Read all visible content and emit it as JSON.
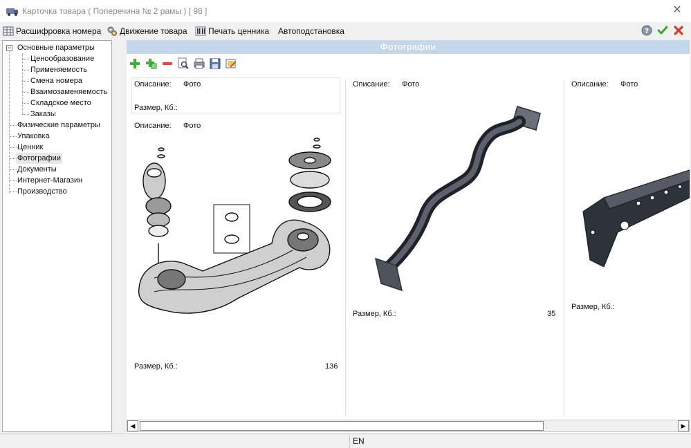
{
  "window": {
    "title": "Карточка товара ( Поперечина № 2 рамы ) [ 98 ]",
    "close_glyph": "✕"
  },
  "menu": [
    {
      "label": "Расшифровка номера",
      "icon": "table-icon"
    },
    {
      "label": "Движение товара",
      "icon": "gears-icon"
    },
    {
      "label": "Печать ценника",
      "icon": "barcode-icon"
    },
    {
      "label": "Автоподстановка",
      "icon": ""
    }
  ],
  "right_icons": [
    "help-icon",
    "confirm-check-icon",
    "cancel-x-icon"
  ],
  "tree": {
    "root": "Основные параметры",
    "children": [
      "Ценообразование",
      "Применяемость",
      "Смена номера",
      "Взаимозаменяемость",
      "Складское место",
      "Заказы"
    ],
    "siblings": [
      "Физические параметры",
      "Упаковка",
      "Ценник",
      "Фотографии",
      "Документы",
      "Интернет-Магазин",
      "Производство"
    ],
    "selected": "Фотографии",
    "expander": "−"
  },
  "section": {
    "title": "Фотографии"
  },
  "photo_toolbar": [
    "add-icon",
    "add-copy-icon",
    "remove-icon",
    "preview-icon",
    "print-icon",
    "save-icon",
    "edit-icon"
  ],
  "cards": [
    {
      "header": {
        "desc_label": "Описание:",
        "desc_value": "Фото",
        "size_label": "Размер, Кб.:",
        "size_value": ""
      },
      "desc_label": "Описание:",
      "desc_value": "Фото",
      "size_label": "Размер, Кб.:",
      "size_value": "136"
    },
    {
      "desc_label": "Описание:",
      "desc_value": "Фото",
      "size_label": "Размер, Кб.:",
      "size_value": "35"
    },
    {
      "desc_label": "Описание:",
      "desc_value": "Фото",
      "size_label": "Размер, Кб.:",
      "size_value": ""
    }
  ],
  "scroll": {
    "left": "◀",
    "right": "▶"
  },
  "status": {
    "lang": "EN"
  },
  "colors": {
    "header_bg": "#c5d7ea",
    "check_green": "#3aa534",
    "cancel_red": "#d93a2b",
    "plus_green": "#3fae3a",
    "minus_red": "#e04a3a"
  }
}
